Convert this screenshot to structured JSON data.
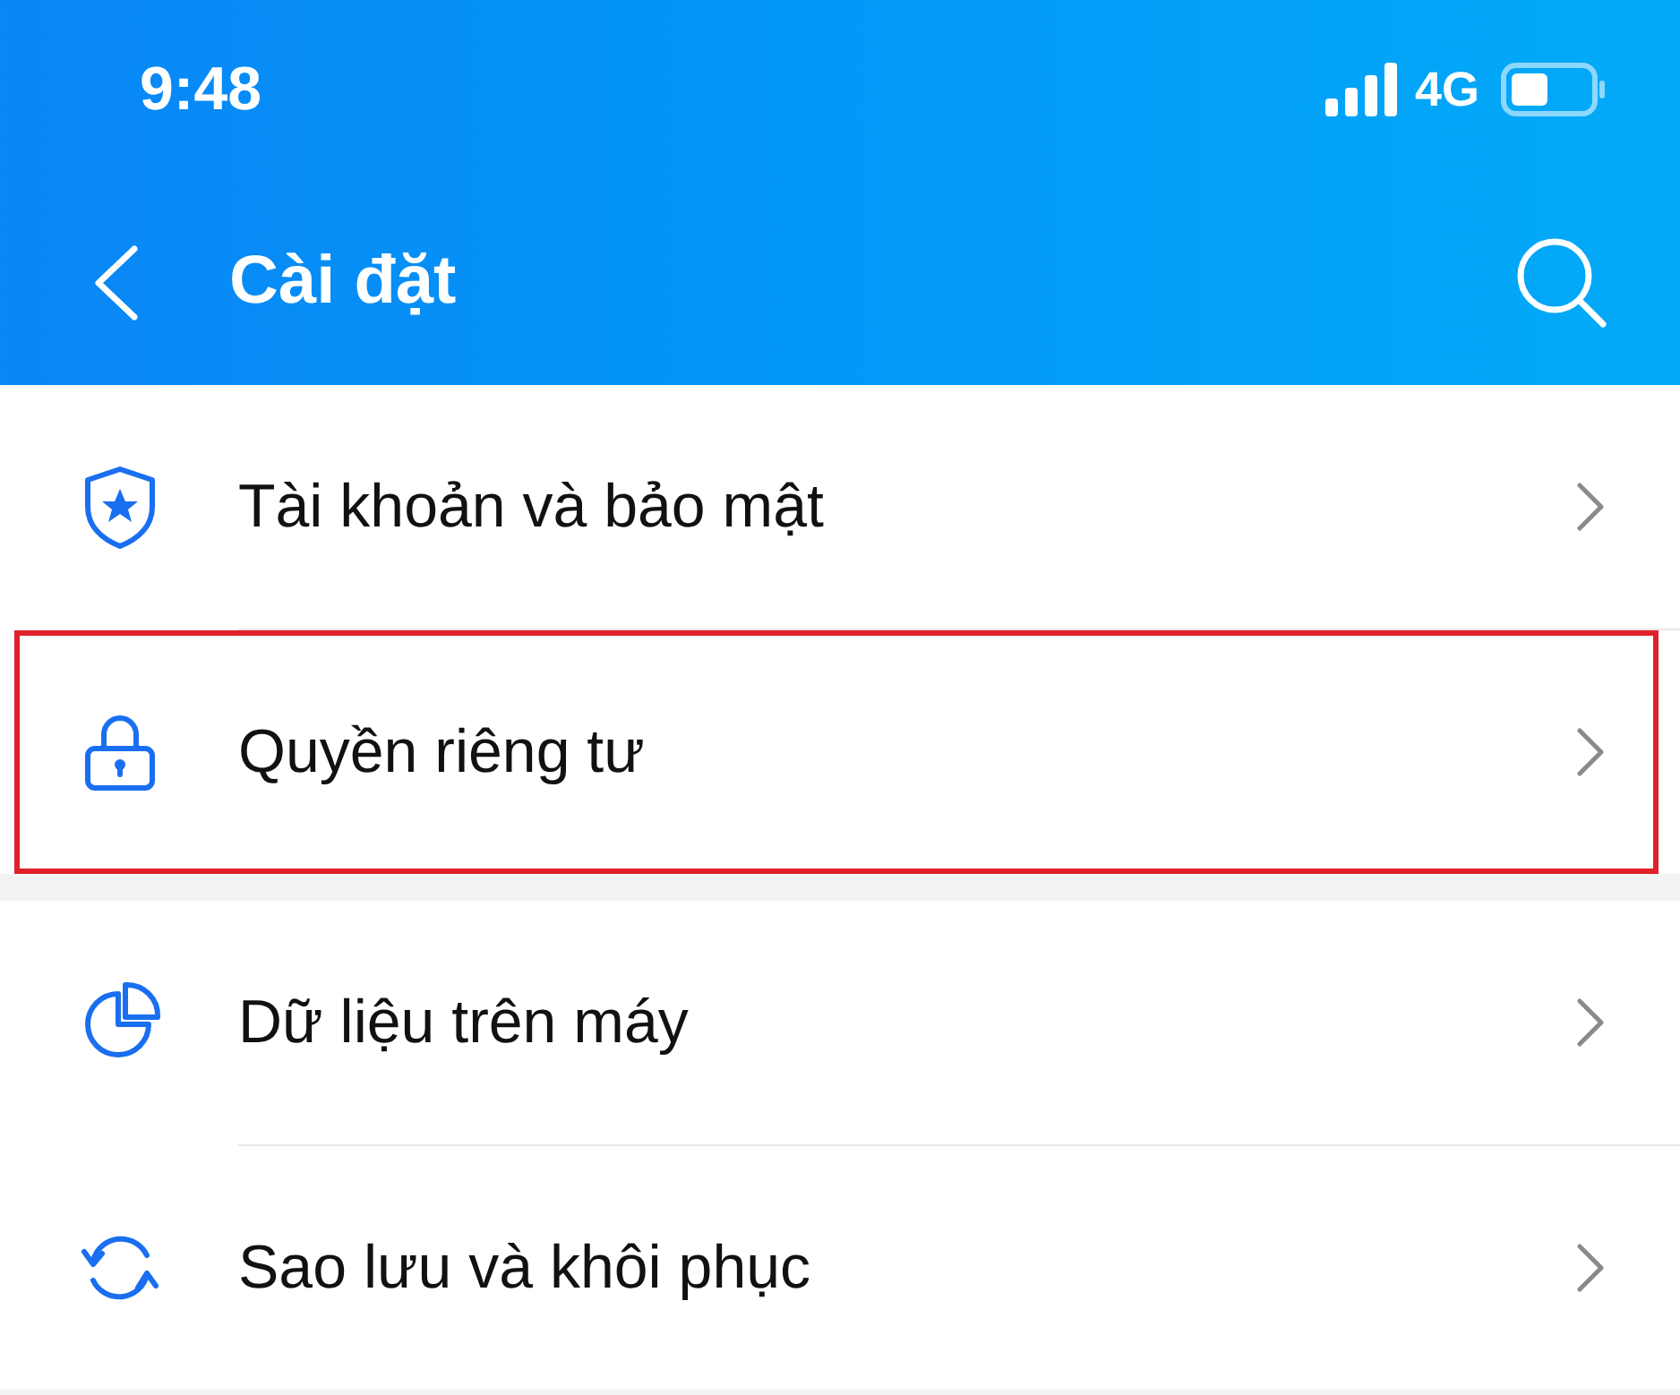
{
  "status_bar": {
    "time": "9:48",
    "network": "4G"
  },
  "header": {
    "title": "Cài đặt"
  },
  "sections": [
    {
      "items": [
        {
          "label": "Tài khoản và bảo mật",
          "highlighted": false
        },
        {
          "label": "Quyền riêng tư",
          "highlighted": true
        }
      ]
    },
    {
      "items": [
        {
          "label": "Dữ liệu trên máy",
          "highlighted": false
        },
        {
          "label": "Sao lưu và khôi phục",
          "highlighted": false
        }
      ]
    }
  ]
}
